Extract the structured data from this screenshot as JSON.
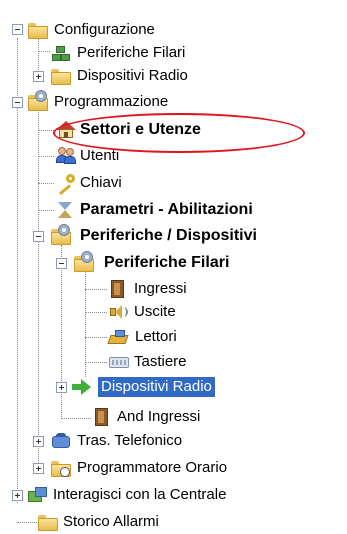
{
  "tree": {
    "configurazione": "Configurazione",
    "periferiche_filari_top": "Periferiche Filari",
    "dispositivi_radio_top": "Dispositivi Radio",
    "programmazione": "Programmazione",
    "settori_utenze": "Settori e Utenze",
    "utenti": "Utenti",
    "chiavi": "Chiavi",
    "parametri": "Parametri - Abilitazioni",
    "periferiche_dispositivi": "Periferiche / Dispositivi",
    "periferiche_filari": "Periferiche Filari",
    "ingressi": "Ingressi",
    "uscite": "Uscite",
    "lettori": "Lettori",
    "tastiere": "Tastiere",
    "dispositivi_radio": "Dispositivi Radio",
    "and_ingressi": "And Ingressi",
    "tras_telefonico": "Tras. Telefonico",
    "programmatore_orario": "Programmatore Orario",
    "interagisci": "Interagisci con la Centrale",
    "storico_allarmi": "Storico Allarmi"
  },
  "selected_item": "Dispositivi Radio",
  "highlight_target": "Settori e Utenze",
  "colors": {
    "selection": "#316ac5",
    "highlight_ellipse": "#e0141c",
    "connector": "#8c8c8c"
  }
}
